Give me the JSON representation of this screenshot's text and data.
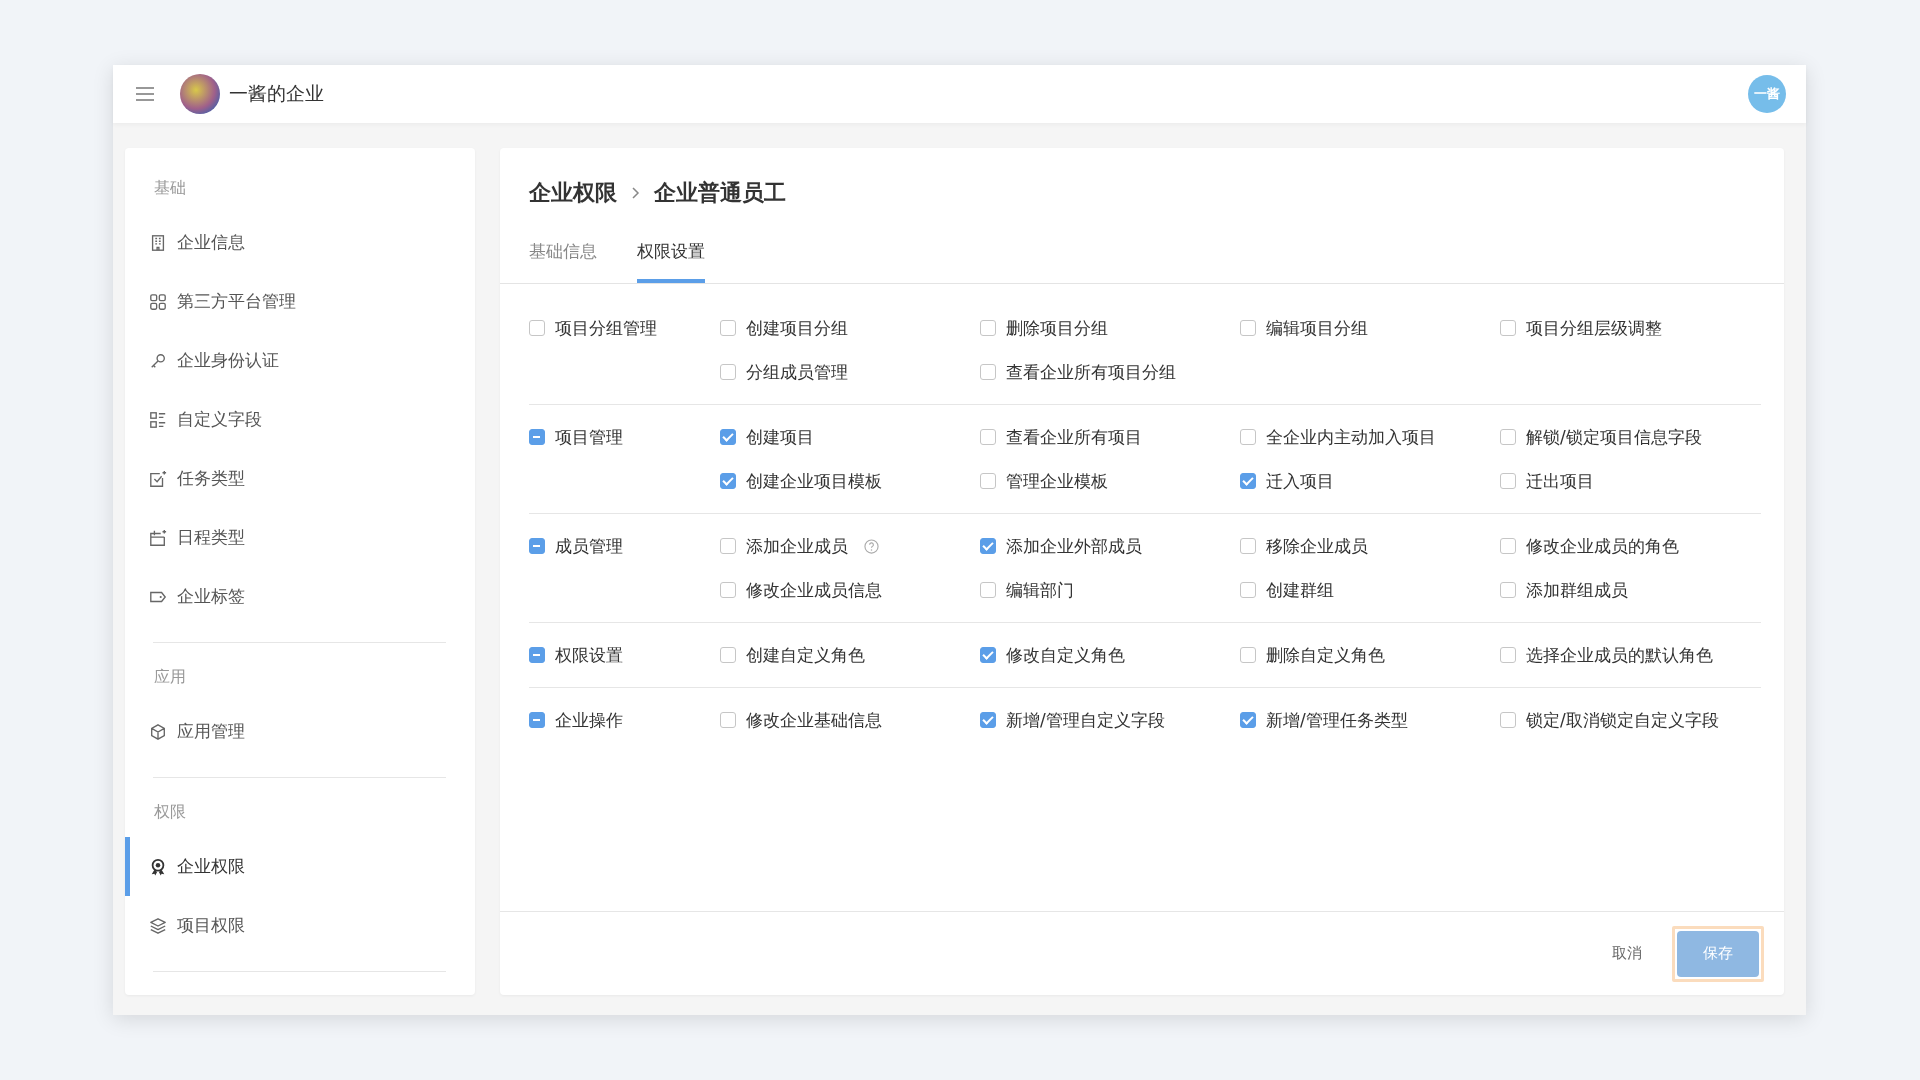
{
  "header": {
    "title": "一酱的企业",
    "avatar_text": "一酱"
  },
  "sidebar": {
    "sections": [
      {
        "label": "基础",
        "items": [
          {
            "label": "企业信息",
            "selected": false
          },
          {
            "label": "第三方平台管理",
            "selected": false
          },
          {
            "label": "企业身份认证",
            "selected": false
          },
          {
            "label": "自定义字段",
            "selected": false
          },
          {
            "label": "任务类型",
            "selected": false
          },
          {
            "label": "日程类型",
            "selected": false
          },
          {
            "label": "企业标签",
            "selected": false
          }
        ]
      },
      {
        "label": "应用",
        "items": [
          {
            "label": "应用管理",
            "selected": false
          }
        ]
      },
      {
        "label": "权限",
        "items": [
          {
            "label": "企业权限",
            "selected": true
          },
          {
            "label": "项目权限",
            "selected": false
          }
        ]
      }
    ]
  },
  "breadcrumb": [
    "企业权限",
    "企业普通员工"
  ],
  "tabs": [
    {
      "label": "基础信息",
      "selected": false
    },
    {
      "label": "权限设置",
      "selected": true
    }
  ],
  "permission_groups": [
    {
      "label": "项目分组管理",
      "partial": false,
      "permissions": [
        {
          "label": "创建项目分组",
          "checked": false
        },
        {
          "label": "删除项目分组",
          "checked": false
        },
        {
          "label": "编辑项目分组",
          "checked": false
        },
        {
          "label": "项目分组层级调整",
          "checked": false
        },
        {
          "label": "分组成员管理",
          "checked": false
        },
        {
          "label": "查看企业所有项目分组",
          "checked": false
        }
      ]
    },
    {
      "label": "项目管理",
      "partial": true,
      "permissions": [
        {
          "label": "创建项目",
          "checked": true
        },
        {
          "label": "查看企业所有项目",
          "checked": false
        },
        {
          "label": "全企业内主动加入项目",
          "checked": false
        },
        {
          "label": "解锁/锁定项目信息字段",
          "checked": false
        },
        {
          "label": "创建企业项目模板",
          "checked": true
        },
        {
          "label": "管理企业模板",
          "checked": false
        },
        {
          "label": "迁入项目",
          "checked": true
        },
        {
          "label": "迁出项目",
          "checked": false
        }
      ]
    },
    {
      "label": "成员管理",
      "partial": true,
      "permissions": [
        {
          "label": "添加企业成员",
          "checked": false,
          "help": true
        },
        {
          "label": "添加企业外部成员",
          "checked": true
        },
        {
          "label": "移除企业成员",
          "checked": false
        },
        {
          "label": "修改企业成员的角色",
          "checked": false
        },
        {
          "label": "修改企业成员信息",
          "checked": false
        },
        {
          "label": "编辑部门",
          "checked": false
        },
        {
          "label": "创建群组",
          "checked": false
        },
        {
          "label": "添加群组成员",
          "checked": false
        }
      ]
    },
    {
      "label": "权限设置",
      "partial": true,
      "permissions": [
        {
          "label": "创建自定义角色",
          "checked": false
        },
        {
          "label": "修改自定义角色",
          "checked": true
        },
        {
          "label": "删除自定义角色",
          "checked": false
        },
        {
          "label": "选择企业成员的默认角色",
          "checked": false
        }
      ]
    },
    {
      "label": "企业操作",
      "partial": true,
      "permissions": [
        {
          "label": "修改企业基础信息",
          "checked": false
        },
        {
          "label": "新增/管理自定义字段",
          "checked": true
        },
        {
          "label": "新增/管理任务类型",
          "checked": true
        },
        {
          "label": "锁定/取消锁定自定义字段",
          "checked": false
        }
      ]
    }
  ],
  "footer": {
    "cancel": "取消",
    "save": "保存"
  }
}
